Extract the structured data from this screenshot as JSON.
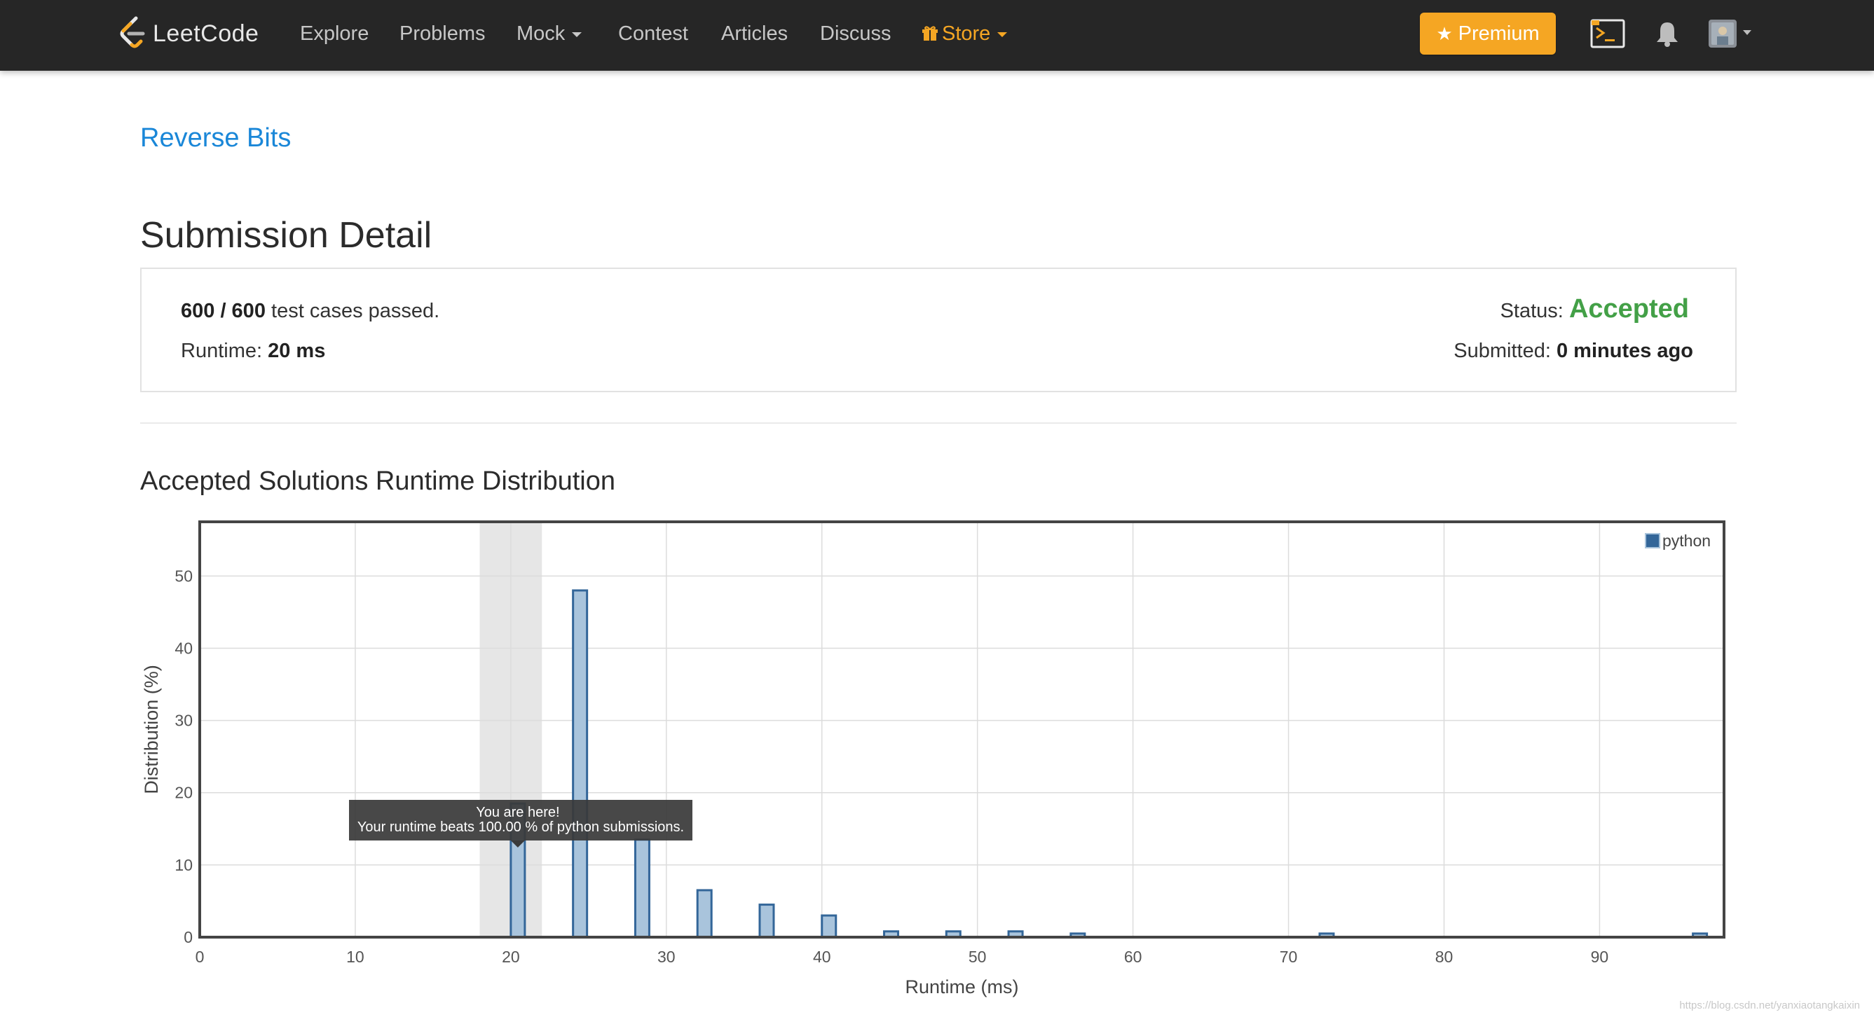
{
  "brand": {
    "name": "LeetCode"
  },
  "nav": {
    "items": [
      {
        "label": "Explore"
      },
      {
        "label": "Problems"
      },
      {
        "label": "Mock"
      },
      {
        "label": "Contest"
      },
      {
        "label": "Articles"
      },
      {
        "label": "Discuss"
      },
      {
        "label": "Store"
      }
    ],
    "premium_label": "Premium",
    "store_color": "#f5a623"
  },
  "problem": {
    "title": "Reverse Bits"
  },
  "submission": {
    "heading": "Submission Detail",
    "passed": "600 / 600",
    "passed_suffix": "test cases passed.",
    "runtime_label": "Runtime:",
    "runtime_value": "20 ms",
    "status_label": "Status:",
    "status_value": "Accepted",
    "status_color": "#43a047",
    "submitted_label": "Submitted:",
    "submitted_value": "0 minutes ago"
  },
  "distribution": {
    "heading": "Accepted Solutions Runtime Distribution"
  },
  "tooltip": {
    "line1": "You are here!",
    "line2": "Your runtime beats 100.00 % of python submissions."
  },
  "chart_data": {
    "type": "bar",
    "title": "",
    "xlabel": "Runtime (ms)",
    "ylabel": "Distribution (%)",
    "xlim": [
      0,
      98
    ],
    "ylim": [
      0,
      57.5
    ],
    "x_ticks": [
      0,
      10,
      20,
      30,
      40,
      50,
      60,
      70,
      80,
      90
    ],
    "y_ticks": [
      0,
      10,
      20,
      30,
      40,
      50
    ],
    "grid": true,
    "legend_position": "top-right",
    "series": [
      {
        "name": "python",
        "color": "#a9c4dc",
        "border_color": "#336699",
        "x": [
          20,
          24,
          28,
          32,
          36,
          40,
          44,
          48,
          52,
          56,
          72,
          96
        ],
        "values": [
          18.5,
          48.0,
          13.5,
          6.5,
          4.5,
          3.0,
          0.8,
          0.8,
          0.8,
          0.5,
          0.5,
          0.5
        ]
      }
    ],
    "highlight": {
      "x_from": 18,
      "x_to": 22,
      "marker_x": 20
    }
  },
  "watermark": "https://blog.csdn.net/yanxiaotangkaixin"
}
